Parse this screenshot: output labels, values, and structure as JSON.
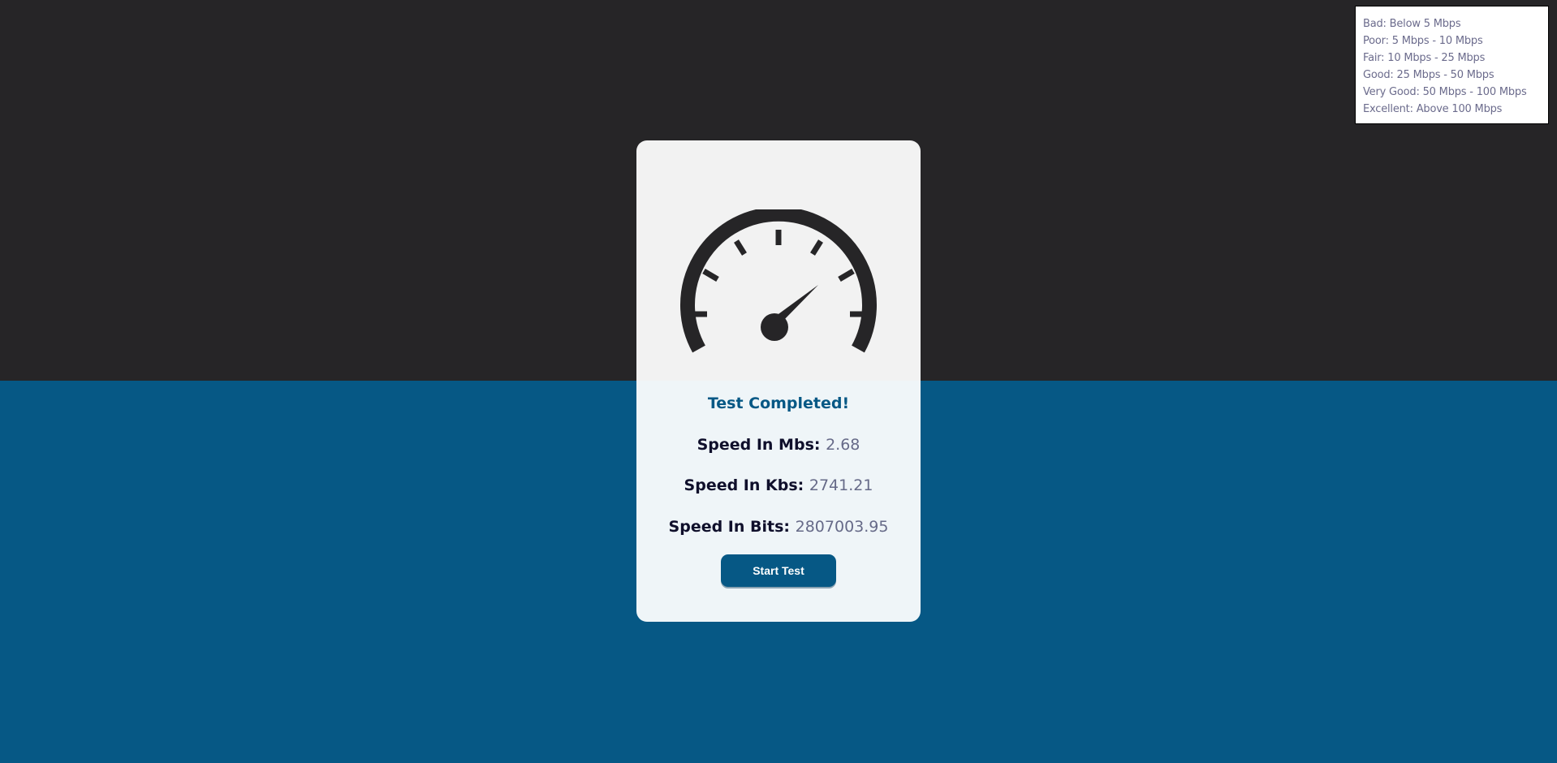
{
  "legend": {
    "items": [
      "Bad: Below 5 Mbps",
      "Poor: 5 Mbps - 10 Mbps",
      "Fair: 10 Mbps - 25 Mbps",
      "Good: 25 Mbps - 50 Mbps",
      "Very Good: 50 Mbps - 100 Mbps",
      "Excellent: Above 100 Mbps"
    ]
  },
  "card": {
    "icon": "speedometer-icon",
    "status": "Test Completed!",
    "mbs_label": "Speed In Mbs:",
    "mbs_value": "2.68",
    "kbs_label": "Speed In Kbs:",
    "kbs_value": "2741.21",
    "bits_label": "Speed In Bits:",
    "bits_value": "2807003.95",
    "start_button": "Start Test"
  },
  "colors": {
    "top_background": "#262527",
    "bottom_background": "#065885",
    "accent": "#065885",
    "gauge": "#262527"
  }
}
